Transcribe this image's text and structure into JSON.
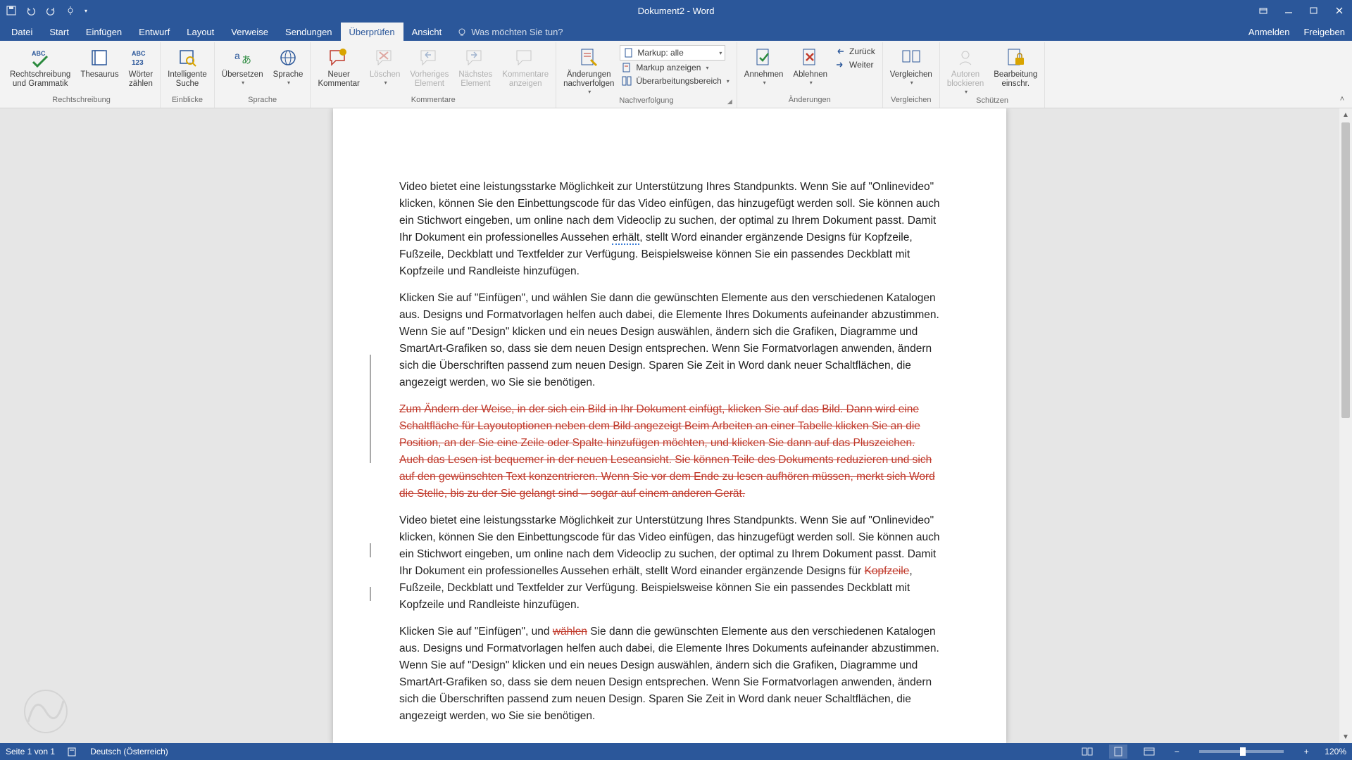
{
  "title": "Dokument2 - Word",
  "qat": {
    "save": "save-icon",
    "undo": "undo-icon",
    "redo": "redo-icon",
    "touch": "touch-icon"
  },
  "tabs": {
    "file": "Datei",
    "items": [
      "Start",
      "Einfügen",
      "Entwurf",
      "Layout",
      "Verweise",
      "Sendungen",
      "Überprüfen",
      "Ansicht"
    ],
    "active_index": 6,
    "tell_me": "Was möchten Sie tun?",
    "signin": "Anmelden",
    "share": "Freigeben"
  },
  "ribbon": {
    "groups": {
      "proofing": {
        "label": "Rechtschreibung",
        "spelling": "Rechtschreibung\nund Grammatik",
        "thesaurus": "Thesaurus",
        "wordcount": "Wörter\nzählen"
      },
      "insights": {
        "label": "Einblicke",
        "smartlookup": "Intelligente\nSuche"
      },
      "language": {
        "label": "Sprache",
        "translate": "Übersetzen",
        "language": "Sprache"
      },
      "comments": {
        "label": "Kommentare",
        "new": "Neuer\nKommentar",
        "delete": "Löschen",
        "prev": "Vorheriges\nElement",
        "next": "Nächstes\nElement",
        "show": "Kommentare\nanzeigen"
      },
      "tracking": {
        "label": "Nachverfolgung",
        "track": "Änderungen\nnachverfolgen",
        "markup_label": "Markup: alle",
        "show_markup": "Markup anzeigen",
        "pane": "Überarbeitungsbereich"
      },
      "changes": {
        "label": "Änderungen",
        "accept": "Annehmen",
        "reject": "Ablehnen",
        "prev": "Zurück",
        "next": "Weiter"
      },
      "compare": {
        "label": "Vergleichen",
        "compare": "Vergleichen"
      },
      "protect": {
        "label": "Schützen",
        "block": "Autoren\nblockieren",
        "restrict": "Bearbeitung\neinschr."
      }
    }
  },
  "document": {
    "p1": "Video bietet eine leistungsstarke Möglichkeit zur Unterstützung Ihres Standpunkts. Wenn Sie auf \"Onlinevideo\" klicken, können Sie den Einbettungscode für das Video einfügen, das hinzugefügt werden soll. Sie können auch ein Stichwort eingeben, um online nach dem Videoclip zu suchen, der optimal zu Ihrem Dokument passt. Damit Ihr Dokument ein professionelles Aussehen ",
    "p1_err": "erhält",
    "p1_b": ", stellt Word einander ergänzende Designs für Kopfzeile, Fußzeile, Deckblatt und Textfelder zur Verfügung. Beispielsweise können Sie ein passendes Deckblatt mit Kopfzeile und Randleiste hinzufügen.",
    "p2": "Klicken Sie auf \"Einfügen\", und wählen Sie dann die gewünschten Elemente aus den verschiedenen Katalogen aus. Designs und Formatvorlagen helfen auch dabei, die Elemente Ihres Dokuments aufeinander abzustimmen. Wenn Sie auf \"Design\" klicken und ein neues Design auswählen, ändern sich die Grafiken, Diagramme und SmartArt-Grafiken so, dass sie dem neuen Design entsprechen. Wenn Sie Formatvorlagen anwenden, ändern sich die Überschriften passend zum neuen Design. Sparen Sie Zeit in Word dank neuer Schaltflächen, die angezeigt werden, wo Sie sie benötigen.",
    "p3_deleted": "Zum Ändern der Weise, in der sich ein Bild in Ihr Dokument einfügt, klicken Sie auf das Bild. Dann wird eine Schaltfläche für Layoutoptionen neben dem Bild angezeigt Beim Arbeiten an einer Tabelle klicken Sie an die Position, an der Sie eine Zeile oder Spalte hinzufügen möchten, und klicken Sie dann auf das Pluszeichen. Auch das Lesen ist bequemer in der neuen Leseansicht. Sie können Teile des Dokuments reduzieren und sich auf den gewünschten Text konzentrieren. Wenn Sie vor dem Ende zu lesen aufhören müssen, merkt sich Word die Stelle, bis zu der Sie gelangt sind – sogar auf einem anderen Gerät.",
    "p4_a": "Video bietet eine leistungsstarke Möglichkeit zur Unterstützung Ihres Standpunkts. Wenn Sie auf \"Onlinevideo\" klicken, können Sie den Einbettungscode für das Video einfügen, das hinzugefügt werden soll. Sie können auch ein Stichwort eingeben, um online nach dem Videoclip zu suchen, der optimal zu Ihrem Dokument passt. Damit Ihr Dokument ein professionelles Aussehen erhält, stellt Word einander ergänzende Designs für ",
    "p4_del": "Kopfzeile",
    "p4_b": ", Fußzeile, Deckblatt und Textfelder zur Verfügung. Beispielsweise können Sie ein passendes Deckblatt mit Kopfzeile und Randleiste hinzufügen.",
    "p5_a": "Klicken Sie auf \"Einfügen\", und ",
    "p5_del": "wählen",
    "p5_b": " Sie dann die gewünschten Elemente aus den verschiedenen Katalogen aus. Designs und Formatvorlagen helfen auch dabei, die Elemente Ihres Dokuments aufeinander abzustimmen. Wenn Sie auf \"Design\" klicken und ein neues Design auswählen, ändern sich die Grafiken, Diagramme und SmartArt-Grafiken so, dass sie dem neuen Design entsprechen. Wenn Sie Formatvorlagen anwenden, ändern sich die Überschriften passend zum neuen Design. Sparen Sie Zeit in Word dank neuer Schaltflächen, die angezeigt werden, wo Sie sie benötigen."
  },
  "status": {
    "page": "Seite 1 von 1",
    "language": "Deutsch (Österreich)",
    "zoom": "120%"
  }
}
